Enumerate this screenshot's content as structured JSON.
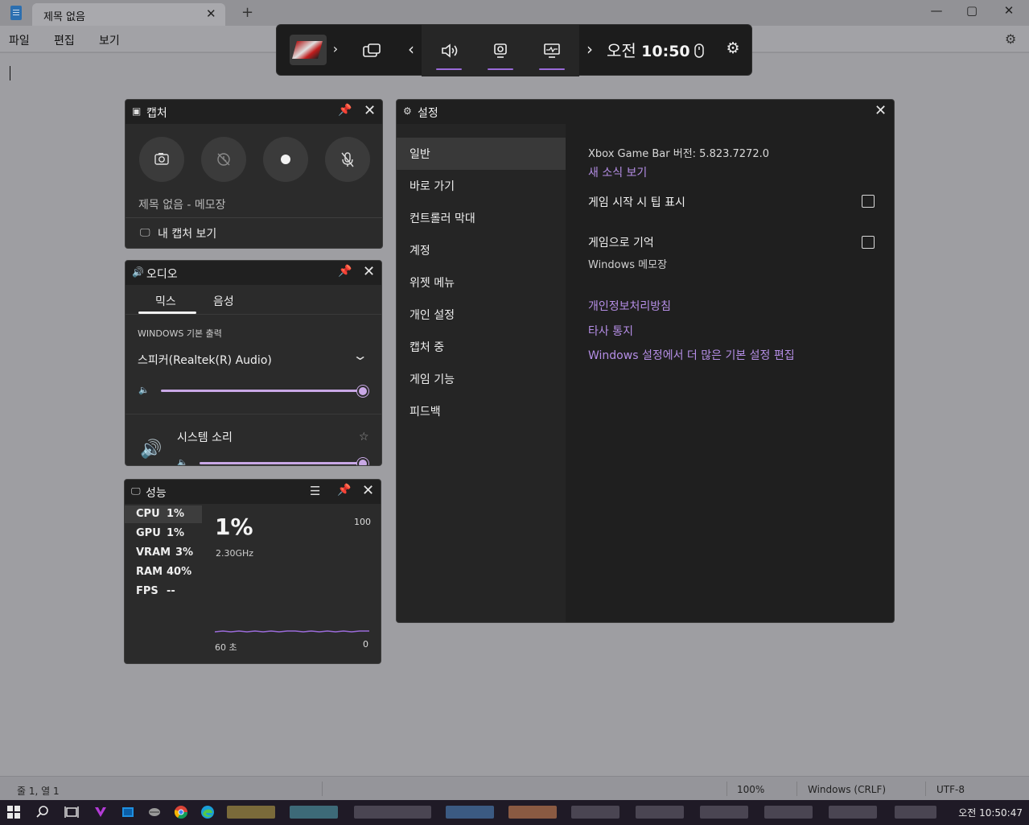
{
  "notepad": {
    "tab_title": "제목 없음",
    "tab_close": "✕",
    "new_tab": "+",
    "window_controls": {
      "minimize": "—",
      "maximize": "▢",
      "close": "✕"
    },
    "menu": [
      "파일",
      "편집",
      "보기"
    ],
    "settings_icon": "gear-icon",
    "status": {
      "position": "줄 1, 열 1",
      "zoom": "100%",
      "line_ending": "Windows (CRLF)",
      "encoding": "UTF-8"
    }
  },
  "gamebar": {
    "time_prefix": "오전",
    "time": "10:50",
    "icons": [
      "widget-menu-icon",
      "audio-icon",
      "capture-icon",
      "performance-icon",
      "mouse-icon",
      "gear-icon"
    ],
    "accent": "#9a6bd9"
  },
  "capture": {
    "title": "캡처",
    "app_name": "제목 없음 - 메모장",
    "view_captures": "내 캡처 보기"
  },
  "audio": {
    "title": "오디오",
    "tabs": [
      "믹스",
      "음성"
    ],
    "output_label": "WINDOWS 기본 출력",
    "device": "스피커(Realtek(R) Audio)",
    "master_volume": 1.0,
    "system_sounds_label": "시스템 소리",
    "system_sounds_volume": 1.0,
    "slider_color": "#c9a8e6"
  },
  "performance": {
    "title": "성능",
    "metrics": [
      {
        "name": "CPU",
        "value": "1%"
      },
      {
        "name": "GPU",
        "value": "1%"
      },
      {
        "name": "VRAM",
        "value": "3%"
      },
      {
        "name": "RAM",
        "value": "40%"
      },
      {
        "name": "FPS",
        "value": "--"
      }
    ],
    "big_value": "1%",
    "frequency": "2.30GHz",
    "max_label": "100",
    "min_label": "0",
    "time_label": "60 초"
  },
  "settings": {
    "title": "설정",
    "nav": [
      "일반",
      "바로 가기",
      "컨트롤러 막대",
      "계정",
      "위젯 메뉴",
      "개인 설정",
      "캡처 중",
      "게임 기능",
      "피드백"
    ],
    "version": "Xbox Game Bar 버전: 5.823.7272.0",
    "whats_new_link": "새 소식 보기",
    "opt_show_tips": "게임 시작 시 팁 표시",
    "opt_remember_game": "게임으로 기억",
    "remember_game_app": "Windows 메모장",
    "privacy_link": "개인정보처리방침",
    "third_party_link": "타사 통지",
    "windows_settings_link": "Windows 설정에서 더 많은 기본 설정 편집",
    "link_color": "#b58ee6"
  },
  "taskbar": {
    "clock": "오전 10:50:47"
  }
}
